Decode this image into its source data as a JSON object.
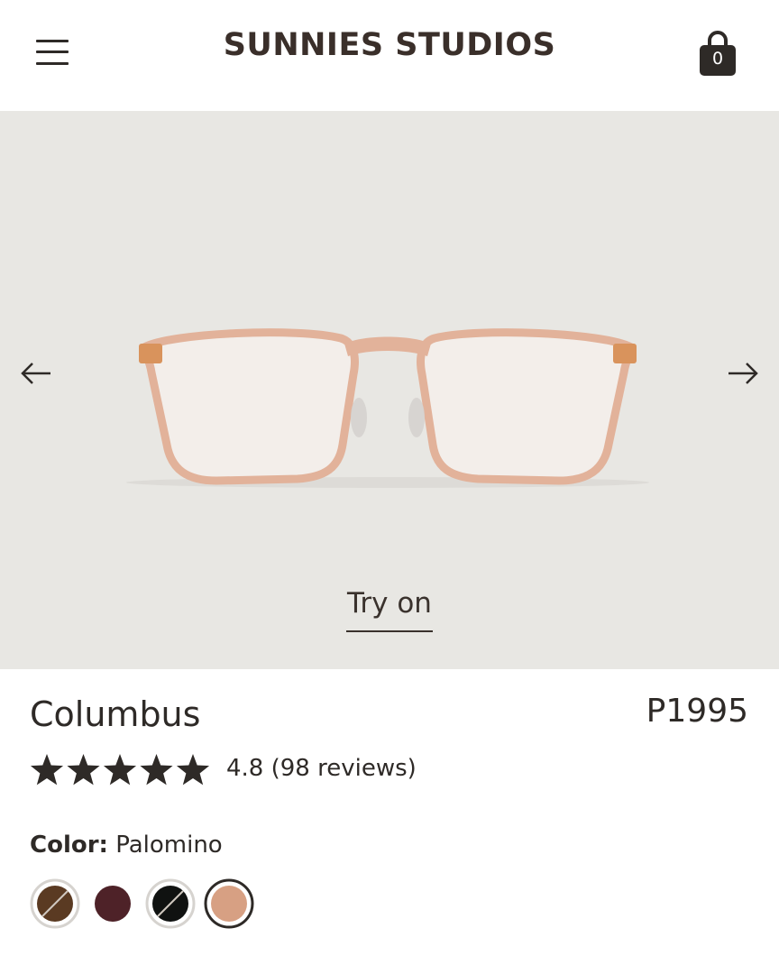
{
  "header": {
    "logo": "SUNNIES STUDIOS",
    "cart_count": "0"
  },
  "hero": {
    "try_on_label": "Try on"
  },
  "product": {
    "name": "Columbus",
    "price": "P1995",
    "rating_value": 4.8,
    "rating_text": "4.8 (98 reviews)",
    "stars_filled": 5,
    "color_label": "Color:",
    "color_value": "Palomino",
    "swatches": [
      {
        "name": "tortoise-brown",
        "color": "#5a3a22",
        "selected": false,
        "striped": true
      },
      {
        "name": "burgundy",
        "color": "#4e2228",
        "selected": false,
        "striped": false
      },
      {
        "name": "black",
        "color": "#101211",
        "selected": false,
        "striped": true
      },
      {
        "name": "palomino",
        "color": "#d7a083",
        "selected": true,
        "striped": false
      }
    ]
  },
  "colors": {
    "text": "#2e2a27",
    "hero_bg": "#e8e7e3",
    "frame": "#e2b29a"
  }
}
